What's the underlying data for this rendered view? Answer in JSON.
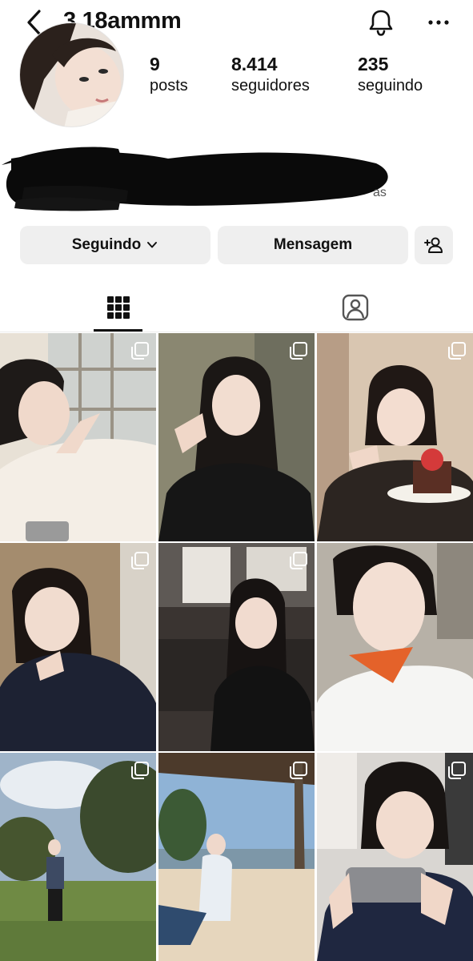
{
  "header": {
    "username": "3.18ammm",
    "back_icon": "chevron-left-icon",
    "bell_icon": "bell-icon",
    "more_icon": "more-horizontal-icon"
  },
  "profile": {
    "stats": {
      "posts": {
        "value": "9",
        "label": "posts"
      },
      "followers": {
        "value": "8.414",
        "label": "seguidores"
      },
      "following": {
        "value": "235",
        "label": "seguindo"
      }
    },
    "bio_tail": "as"
  },
  "actions": {
    "following_label": "Seguindo",
    "message_label": "Mensagem",
    "add_user_icon": "add-user-icon",
    "following_chevron_icon": "chevron-down-icon"
  },
  "tabs": [
    {
      "name": "posts-grid",
      "icon": "grid-icon",
      "active": true
    },
    {
      "name": "tagged",
      "icon": "tagged-person-icon",
      "active": false
    }
  ],
  "posts": [
    {
      "id": 1,
      "multiple": true
    },
    {
      "id": 2,
      "multiple": true
    },
    {
      "id": 3,
      "multiple": true
    },
    {
      "id": 4,
      "multiple": true
    },
    {
      "id": 5,
      "multiple": true
    },
    {
      "id": 6,
      "multiple": false
    },
    {
      "id": 7,
      "multiple": true
    },
    {
      "id": 8,
      "multiple": true
    },
    {
      "id": 9,
      "multiple": true
    }
  ]
}
